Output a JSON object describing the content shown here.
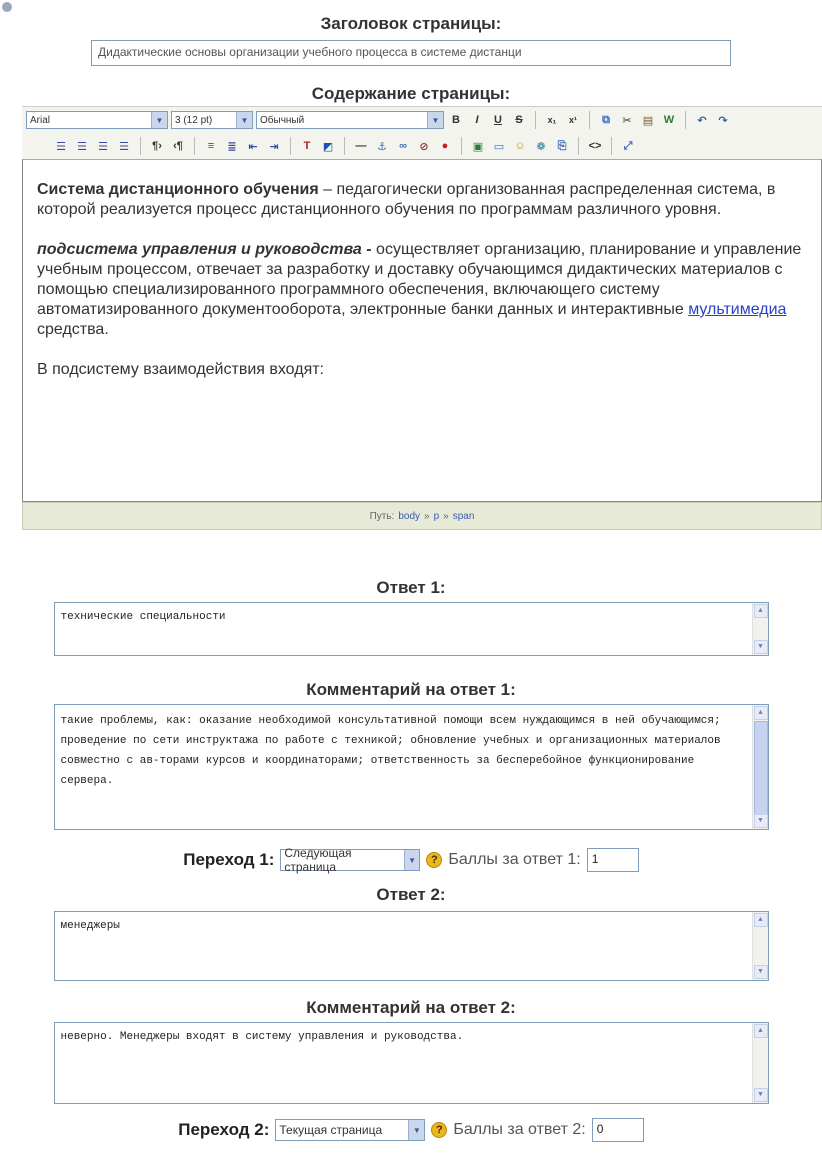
{
  "page_title_label": "Заголовок страницы:",
  "page_title_value": "Дидактические основы организации учебного процесса в системе дистанци",
  "content_label": "Содержание страницы:",
  "toolbar": {
    "font": "Arial",
    "size": "3 (12 pt)",
    "style": "Обычный"
  },
  "editor": {
    "p1_bold": "Система дистанционного обучения",
    "p1_rest": " – педагогически организованная распределенная система, в которой реализуется процесс дистанционного обучения по программам различного уровня.",
    "p2_bold": "подсистема управления и руководства -",
    "p2_rest_1": " осуществляет организацию, планирование и управление учебным процессом, отвечает за разработку и доставку обучающимся дидактических материалов с помощью специализированного программного обеспечения, включающего систему автоматизированного документооборота, электронные банки данных и интерактивные ",
    "p2_link": "мультимедиа",
    "p2_rest_2": " средства.",
    "p3": "В подсистему взаимодействия входят:"
  },
  "path": {
    "label": "Путь:",
    "body": "body",
    "p": "p",
    "span": "span",
    "sep": "»"
  },
  "answers": [
    {
      "answer_label": "Ответ 1:",
      "answer_text": "технические специальности",
      "comment_label": "Комментарий на ответ 1:",
      "comment_text": "такие проблемы, как: оказание необходимой консультативной помощи всем нуждающимся в ней обучающимся; проведение по сети инструктажа по работе с техникой; обновление учебных и организационных материалов совместно с ав-торами курсов и координаторами; ответственность за бесперебойное функционирование сервера.",
      "jump_label": "Переход 1:",
      "jump_value": "Следующая страница",
      "score_label": "Баллы за ответ 1:",
      "score_value": "1"
    },
    {
      "answer_label": "Ответ 2:",
      "answer_text": "менеджеры",
      "comment_label": "Комментарий на ответ 2:",
      "comment_text": "неверно. Менеджеры входят в систему управления и руководства.",
      "jump_label": "Переход 2:",
      "jump_value": "Текущая страница",
      "score_label": "Баллы за ответ 2:",
      "score_value": "0"
    }
  ]
}
